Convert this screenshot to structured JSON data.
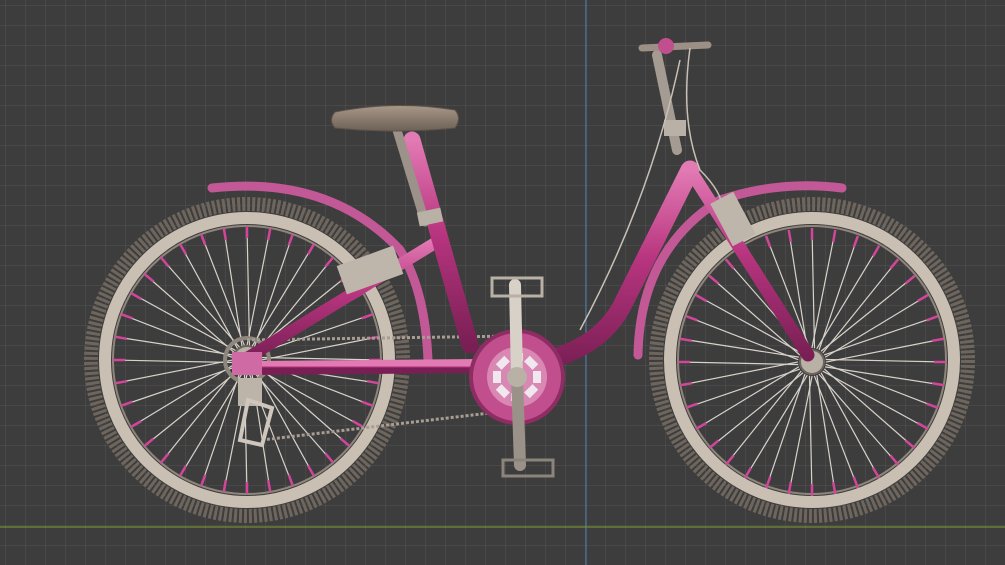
{
  "viewport": {
    "background_color": "#3d3d3d",
    "grid_color": "#4a4a4a",
    "axis_y_color": "#4f7fb8",
    "axis_x_color": "#7f9f2a"
  },
  "bicycle": {
    "frame_color": "#b8357f",
    "frame_highlight": "#e27ab4",
    "tire_color": "#6e665d",
    "rim_color": "#c9bfb2",
    "spoke_color": "#d8d2ca",
    "nipple_color": "#d0479a",
    "saddle_color": "#8c7d70",
    "metal_color": "#b9b0a6",
    "chainring_color": "#c24f8d"
  },
  "icons": [
    "bicycle-icon"
  ]
}
